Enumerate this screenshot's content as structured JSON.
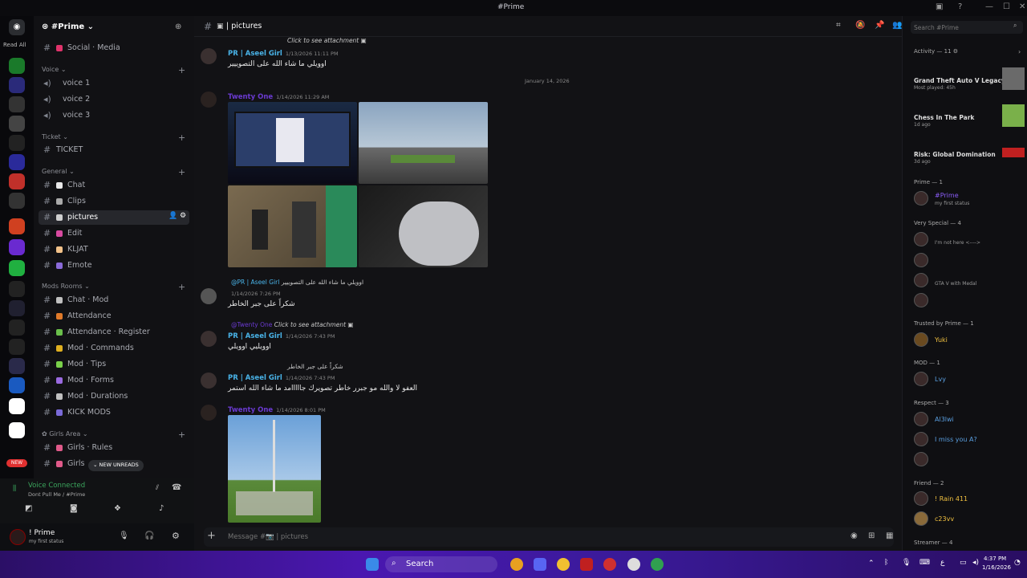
{
  "window": {
    "title": "#Prime"
  },
  "rail": {
    "read_all": "Read All",
    "new_badge": "NEW"
  },
  "server": {
    "name": "#Prime"
  },
  "sidebar": {
    "channels_top": [
      {
        "label": "Social · Media",
        "emoji_color": "#e0336b"
      }
    ],
    "voice_cat": "Voice",
    "voice": [
      {
        "label": "voice 1"
      },
      {
        "label": "voice 2"
      },
      {
        "label": "voice 3"
      }
    ],
    "ticket_cat": "Ticket",
    "ticket": [
      {
        "label": "TICKET"
      }
    ],
    "general_cat": "General",
    "general": [
      {
        "label": "Chat",
        "emoji_color": "#e8e8e8"
      },
      {
        "label": "Clips",
        "emoji_color": "#aaaaaa"
      },
      {
        "label": "pictures",
        "emoji_color": "#cfcfcf"
      },
      {
        "label": "Edit",
        "emoji_color": "#d84aa0"
      },
      {
        "label": "KLJAT",
        "emoji_color": "#f2c28a"
      },
      {
        "label": "Emote",
        "emoji_color": "#8a6ad8"
      }
    ],
    "mods_cat": "Mods Rooms",
    "mods": [
      {
        "label": "Chat · Mod",
        "emoji_color": "#c0c0c0"
      },
      {
        "label": "Attendance",
        "emoji_color": "#e07a2a"
      },
      {
        "label": "Attendance · Register",
        "emoji_color": "#6abf4b"
      },
      {
        "label": "Mod · Commands",
        "emoji_color": "#e0b020"
      },
      {
        "label": "Mod · Tips",
        "emoji_color": "#7ad04a"
      },
      {
        "label": "Mod · Forms",
        "emoji_color": "#9a6ae0"
      },
      {
        "label": "Mod · Durations",
        "emoji_color": "#c0c0c0"
      },
      {
        "label": "KICK MODS",
        "emoji_color": "#7a6ad8"
      }
    ],
    "girls_cat": "Girls Area",
    "girls": [
      {
        "label": "Girls · Rules",
        "emoji_color": "#e05a8a"
      },
      {
        "label": "Girls",
        "emoji_color": "#e05a8a"
      }
    ],
    "new_unreads": "NEW UNREADS"
  },
  "voice_panel": {
    "status": "Voice Connected",
    "sub": "Dont Pull Me / #Prime"
  },
  "user_panel": {
    "name": "! Prime",
    "status": "my first status"
  },
  "channel": {
    "name": "pictures"
  },
  "messages": {
    "m1_reply": "Click to see attachment",
    "m1_author": "PR | Aseel Girl",
    "m1_time": "1/13/2026 11:11 PM",
    "m1_text": "اوويلي ما شاء الله على التصوييير",
    "divider": "January 14, 2026",
    "m2_author": "Twenty One",
    "m2_time": "1/14/2026 11:29 AM",
    "m3_reply_name": "@PR | Aseel Girl",
    "m3_reply": "اوويلي ما شاء الله على التصوييير",
    "m3_time": "1/14/2026 7:26 PM",
    "m3_text": "شكراً على جبر الخاطر",
    "m4_reply_name": "@Twenty One",
    "m4_reply": "Click to see attachment",
    "m4_author": "PR | Aseel Girl",
    "m4_time": "1/14/2026 7:43 PM",
    "m4_text": "اوويليي اوويلي",
    "m5_reply": "شكراً على جبر الخاطر",
    "m5_author": "PR | Aseel Girl",
    "m5_time": "1/14/2026 7:43 PM",
    "m5_text": "العفو لا والله مو جبرر خاطر تصويرك جااااامد ما شاء الله استمر",
    "m6_author": "Twenty One",
    "m6_time": "1/14/2026 8:01 PM"
  },
  "composer": {
    "placeholder": "Message #📷 | pictures"
  },
  "right": {
    "search": "Search #Prime",
    "activity_hdr": "Activity — 11",
    "activities": [
      {
        "title": "Grand Theft Auto V Legacy",
        "sub": "Most played: 45h"
      },
      {
        "title": "Chess In The Park",
        "sub": "1d ago"
      },
      {
        "title": "Risk: Global Domination",
        "sub": "3d ago"
      }
    ],
    "groups": [
      {
        "header": "Prime — 1",
        "members": [
          {
            "name": "#Prime",
            "color": "#8a5cf6",
            "status": "my first status"
          }
        ]
      },
      {
        "header": "Very Special — 4",
        "members": [
          {
            "name": "",
            "color": "#e05050",
            "status": "I'm not here <---->"
          },
          {
            "name": "",
            "color": "#e05050",
            "status": ""
          },
          {
            "name": "",
            "color": "#e05050",
            "status": "GTA V with Medal"
          },
          {
            "name": "",
            "color": "#e05050",
            "status": ""
          }
        ]
      },
      {
        "header": "Trusted by Prime — 1",
        "members": [
          {
            "name": "Yuki",
            "color": "#f0c040",
            "status": ""
          }
        ]
      },
      {
        "header": "MOD — 1",
        "members": [
          {
            "name": "Lvy",
            "color": "#5a9fe0",
            "status": ""
          }
        ]
      },
      {
        "header": "Respect — 3",
        "members": [
          {
            "name": "Al3lwi",
            "color": "#5a9fe0",
            "status": ""
          },
          {
            "name": "I miss you A?",
            "color": "#5a9fe0",
            "status": ""
          },
          {
            "name": "",
            "color": "#5a9fe0",
            "status": ""
          }
        ]
      },
      {
        "header": "Friend — 2",
        "members": [
          {
            "name": "! Rain 411",
            "color": "#f0c040",
            "status": ""
          },
          {
            "name": "c23vv",
            "color": "#f0c040",
            "status": ""
          }
        ]
      },
      {
        "header": "Streamer — 4",
        "members": []
      }
    ]
  },
  "taskbar": {
    "search": "Search",
    "time": "4:37 PM",
    "date": "1/16/2026",
    "lang": "ع"
  }
}
